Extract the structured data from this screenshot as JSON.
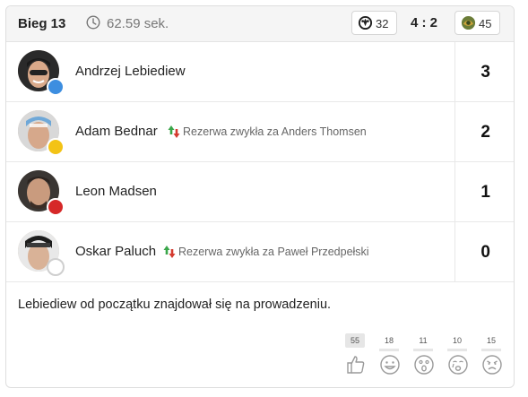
{
  "header": {
    "heat_title": "Bieg 13",
    "time": "62.59 sek.",
    "home_team_count": "32",
    "score": "4 : 2",
    "away_team_count": "45"
  },
  "riders": [
    {
      "name": "Andrzej Lebiediew",
      "points": "3",
      "helmet_color": "#3d8ee0",
      "swap": ""
    },
    {
      "name": "Adam Bednar",
      "points": "2",
      "helmet_color": "#f3c316",
      "swap": "Rezerwa zwykła za Anders Thomsen"
    },
    {
      "name": "Leon Madsen",
      "points": "1",
      "helmet_color": "#d62828",
      "swap": ""
    },
    {
      "name": "Oskar Paluch",
      "points": "0",
      "helmet_color": "#ffffff",
      "swap": "Rezerwa zwykła za Paweł Przedpełski"
    }
  ],
  "comment": "Lebiediew od początku znajdował się na prowadzeniu.",
  "reactions": [
    {
      "icon": "thumbs-up-icon",
      "count": "55",
      "active": true
    },
    {
      "icon": "smile-icon",
      "count": "18",
      "active": false
    },
    {
      "icon": "surprised-icon",
      "count": "11",
      "active": false
    },
    {
      "icon": "crying-icon",
      "count": "10",
      "active": false
    },
    {
      "icon": "angry-icon",
      "count": "15",
      "active": false
    }
  ]
}
